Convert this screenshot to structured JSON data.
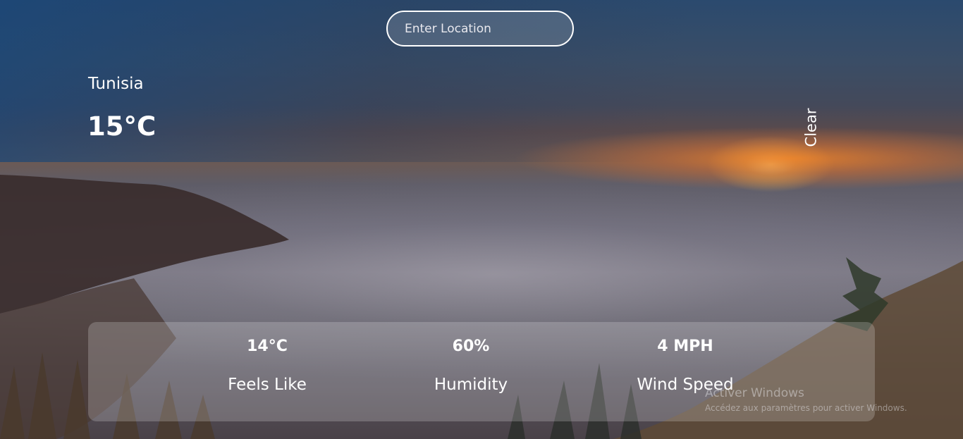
{
  "search": {
    "placeholder": "Enter Location"
  },
  "weather": {
    "location": "Tunisia",
    "temperature": "15°C",
    "condition": "Clear"
  },
  "stats": [
    {
      "value": "14°C",
      "label": "Feels Like"
    },
    {
      "value": "60%",
      "label": "Humidity"
    },
    {
      "value": "4 MPH",
      "label": "Wind Speed"
    }
  ],
  "watermark": {
    "title": "Activer Windows",
    "subtitle": "Accédez aux paramètres pour activer Windows."
  }
}
